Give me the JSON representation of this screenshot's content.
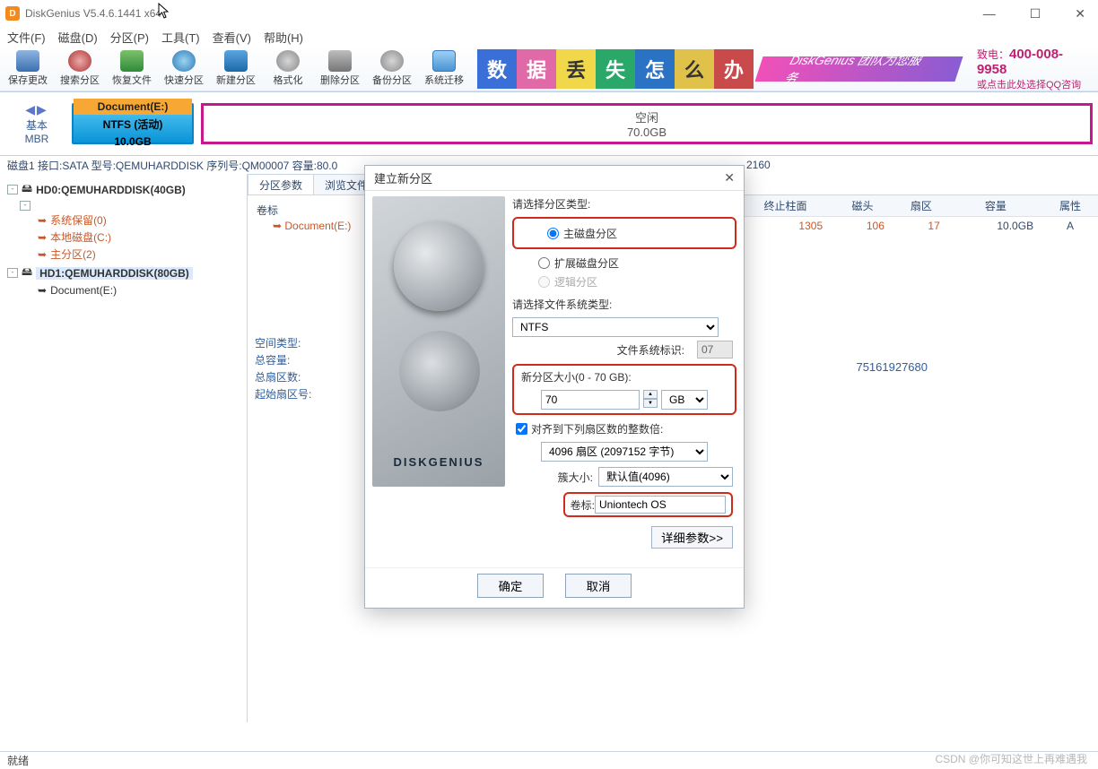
{
  "title": "DiskGenius V5.4.6.1441 x64",
  "menu": {
    "file": "文件(F)",
    "disk": "磁盘(D)",
    "part": "分区(P)",
    "tool": "工具(T)",
    "view": "查看(V)",
    "help": "帮助(H)"
  },
  "toolbar": {
    "save": "保存更改",
    "search": "搜索分区",
    "recover": "恢复文件",
    "quick": "快速分区",
    "newp": "新建分区",
    "format": "格式化",
    "delete": "删除分区",
    "backup": "备份分区",
    "migrate": "系统迁移"
  },
  "banner": {
    "chars": [
      "数",
      "据",
      "丢",
      "失",
      "怎",
      "么",
      "办"
    ],
    "slogan": "DiskGenius 团队为您服务",
    "phone_label": "致电：",
    "phone": "400-008-9958",
    "phone_sub": "或点击此处选择QQ咨询"
  },
  "diskbar": {
    "basic": "基本",
    "mbr": "MBR",
    "part_name": "Document(E:)",
    "part_fs": "NTFS (活动)",
    "part_size": "10.0GB",
    "free_label": "空闲",
    "free_size": "70.0GB"
  },
  "diskinfo_prefix": "磁盘1 接口:SATA 型号:QEMUHARDDISK 序列号:QM00007 容量:80.0",
  "diskinfo_suffix": "2160",
  "tree": {
    "hd0": "HD0:QEMUHARDDISK(40GB)",
    "hd0_items": {
      "a": "系统保留(0)",
      "b": "本地磁盘(C:)",
      "c": "主分区(2)"
    },
    "hd1": "HD1:QEMUHARDDISK(80GB)",
    "hd1_items": {
      "a": "Document(E:)"
    }
  },
  "tabs": {
    "params": "分区参数",
    "browse": "浏览文件"
  },
  "vol_label": "卷标",
  "volume_name": "Document(E:)",
  "cols": {
    "endcyl": "终止柱面",
    "head": "磁头",
    "sector": "扇区",
    "cap": "容量",
    "attr": "属性"
  },
  "row": {
    "endcyl": "1305",
    "head": "106",
    "sector": "17",
    "cap": "10.0GB",
    "attr": "A"
  },
  "space": {
    "type": "空间类型:",
    "total": "总容量:",
    "sectors": "总扇区数:",
    "start": "起始扇区号:"
  },
  "bignum": "75161927680",
  "dialog": {
    "title": "建立新分区",
    "type_label": "请选择分区类型:",
    "type_primary": "主磁盘分区",
    "type_extended": "扩展磁盘分区",
    "type_logical": "逻辑分区",
    "fs_label": "请选择文件系统类型:",
    "fs_value": "NTFS",
    "fsid_label": "文件系统标识:",
    "fsid_value": "07",
    "size_label": "新分区大小(0 - 70 GB):",
    "size_value": "70",
    "size_unit": "GB",
    "align_label": "对齐到下列扇区数的整数倍:",
    "align_value": "4096 扇区 (2097152 字节)",
    "cluster_label": "簇大小:",
    "cluster_value": "默认值(4096)",
    "vol_label": "卷标:",
    "vol_value": "Uniontech OS",
    "detail": "详细参数>>",
    "ok": "确定",
    "cancel": "取消",
    "imgtext": "DISKGENIUS"
  },
  "status": "就绪",
  "watermark": "CSDN @你可知这世上再难遇我"
}
